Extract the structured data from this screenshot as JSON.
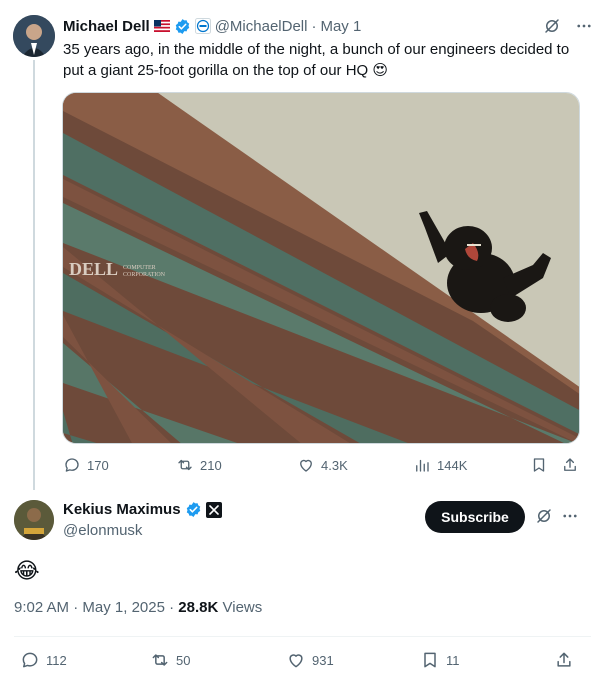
{
  "parent_tweet": {
    "author_name": "Michael Dell",
    "handle": "@MichaelDell",
    "separator": "·",
    "date": "May 1",
    "text": "35 years ago, in the middle of the night, a bunch of our engineers decided to put a giant 25-foot gorilla on the top of our HQ 😍",
    "media": {
      "building_sign": "DELL",
      "building_sign_sub1": "COMPUTER",
      "building_sign_sub2": "CORPORATION"
    },
    "actions": {
      "replies": "170",
      "reposts": "210",
      "likes": "4.3K",
      "views": "144K"
    }
  },
  "reply_tweet": {
    "author_name": "Kekius Maximus",
    "handle": "@elonmusk",
    "subscribe_label": "Subscribe",
    "text": "😂",
    "time": "9:02 AM",
    "date": "May 1, 2025",
    "views_count": "28.8K",
    "views_label": "Views",
    "actions": {
      "replies": "112",
      "reposts": "50",
      "likes": "931",
      "bookmarks": "11"
    }
  },
  "colors": {
    "verified_blue": "#1d9bf0",
    "text_primary": "#0f1419",
    "text_secondary": "#536471",
    "button_dark": "#0f1419"
  }
}
